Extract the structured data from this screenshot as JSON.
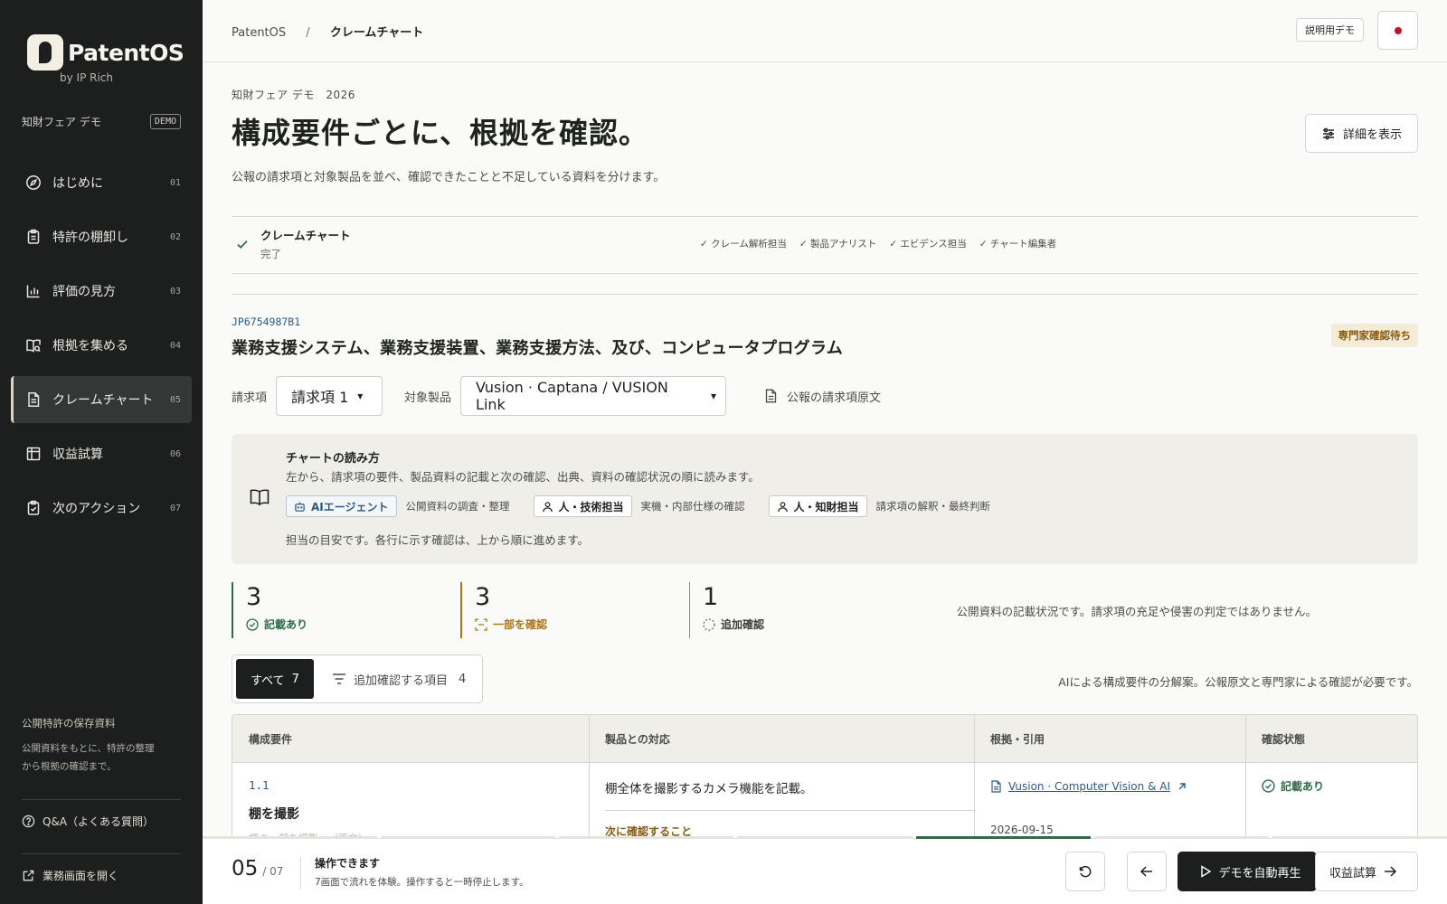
{
  "brand": {
    "name": "PatentOS",
    "sub": "by IP Rich"
  },
  "workspace": {
    "name": "知財フェア デモ",
    "badge": "DEMO"
  },
  "nav": [
    {
      "label": "はじめに",
      "num": "01",
      "icon": "compass-icon"
    },
    {
      "label": "特許の棚卸し",
      "num": "02",
      "icon": "clipboard-icon"
    },
    {
      "label": "評価の見方",
      "num": "03",
      "icon": "bar-chart-icon"
    },
    {
      "label": "根拠を集める",
      "num": "04",
      "icon": "book-search-icon"
    },
    {
      "label": "クレームチャート",
      "num": "05",
      "icon": "document-icon",
      "active": true
    },
    {
      "label": "収益試算",
      "num": "06",
      "icon": "table-icon"
    },
    {
      "label": "次のアクション",
      "num": "07",
      "icon": "clipboard-check-icon"
    }
  ],
  "sidebar_footer": {
    "title": "公開特許の保存資料",
    "desc": "公開資料をもとに、特許の整理から根拠の確認まで。",
    "qa": "Q&A（よくある質問）",
    "open_app": "業務画面を開く"
  },
  "topbar": {
    "crumb_root": "PatentOS",
    "crumb_sep": "/",
    "crumb_current": "クレームチャート",
    "demo_button": "説明用デモ"
  },
  "header": {
    "eyebrow": "知財フェア デモ　2026",
    "title": "構成要件ごとに、根拠を確認。",
    "subtitle": "公報の請求項と対象製品を並べ、確認できたことと不足している資料を分けます。",
    "detail_button": "詳細を表示"
  },
  "status": {
    "title": "クレームチャート",
    "state": "完了",
    "roles": [
      "クレーム解析担当",
      "製品アナリスト",
      "エビデンス担当",
      "チャート編集者"
    ]
  },
  "patent": {
    "number": "JP6754987B1",
    "title": "業務支援システム、業務支援装置、業務支援方法、及び、コンピュータプログラム",
    "badge": "専門家確認待ち"
  },
  "filters": {
    "claim_label": "請求項",
    "claim_value": "請求項 1",
    "product_label": "対象製品",
    "product_value": "Vusion · Captana / VUSION Link",
    "source_link": "公報の請求項原文"
  },
  "howto": {
    "title": "チャートの読み方",
    "desc": "左から、請求項の要件、製品資料の記載と次の確認、出典、資料の確認状況の順に読みます。",
    "roles": [
      {
        "chip": "AIエージェント",
        "desc": "公開資料の調査・整理",
        "type": "ai"
      },
      {
        "chip": "人・技術担当",
        "desc": "実機・内部仕様の確認",
        "type": "person"
      },
      {
        "chip": "人・知財担当",
        "desc": "請求項の解釈・最終判断",
        "type": "person"
      }
    ],
    "note": "担当の目安です。各行に示す確認は、上から順に進めます。"
  },
  "stats": [
    {
      "num": "3",
      "label": "記載あり",
      "color": "#2f6b48"
    },
    {
      "num": "3",
      "label": "一部を確認",
      "color": "#b0731a"
    },
    {
      "num": "1",
      "label": "追加確認",
      "color": "#6a6e6b"
    }
  ],
  "stats_note": "公開資料の記載状況です。請求項の充足や侵害の判定ではありません。",
  "tabs": {
    "all_label": "すべて",
    "all_count": "7",
    "more_label": "追加確認する項目",
    "more_count": "4"
  },
  "ai_note": "AIによる構成要件の分解案。公報原文と専門家による確認が必要です。",
  "table": {
    "headers": [
      "構成要件",
      "製品との対応",
      "根拠・引用",
      "確認状態"
    ],
    "rows": [
      {
        "num": "1.1",
        "element": "棚を撮影",
        "faded": "棚の一部を撮影…（原文）",
        "mapping": "棚全体を撮影するカメラ機能を記載。",
        "next_label": "次に確認すること",
        "ref": "Vusion · Computer Vision & AI",
        "date": "2026-09-15",
        "status": "記載あり"
      }
    ]
  },
  "footer": {
    "step_current": "05",
    "step_total": "/ 07",
    "title": "操作できます",
    "desc": "7画面で流れを体験。操作すると一時停止します。",
    "autoplay": "デモを自動再生",
    "next": "収益試算"
  },
  "colors": {
    "accent_green": "#2f6b48",
    "accent_amber": "#b0731a",
    "link_blue": "#2b5a8a",
    "sidebar_bg": "#1c1f1d"
  }
}
